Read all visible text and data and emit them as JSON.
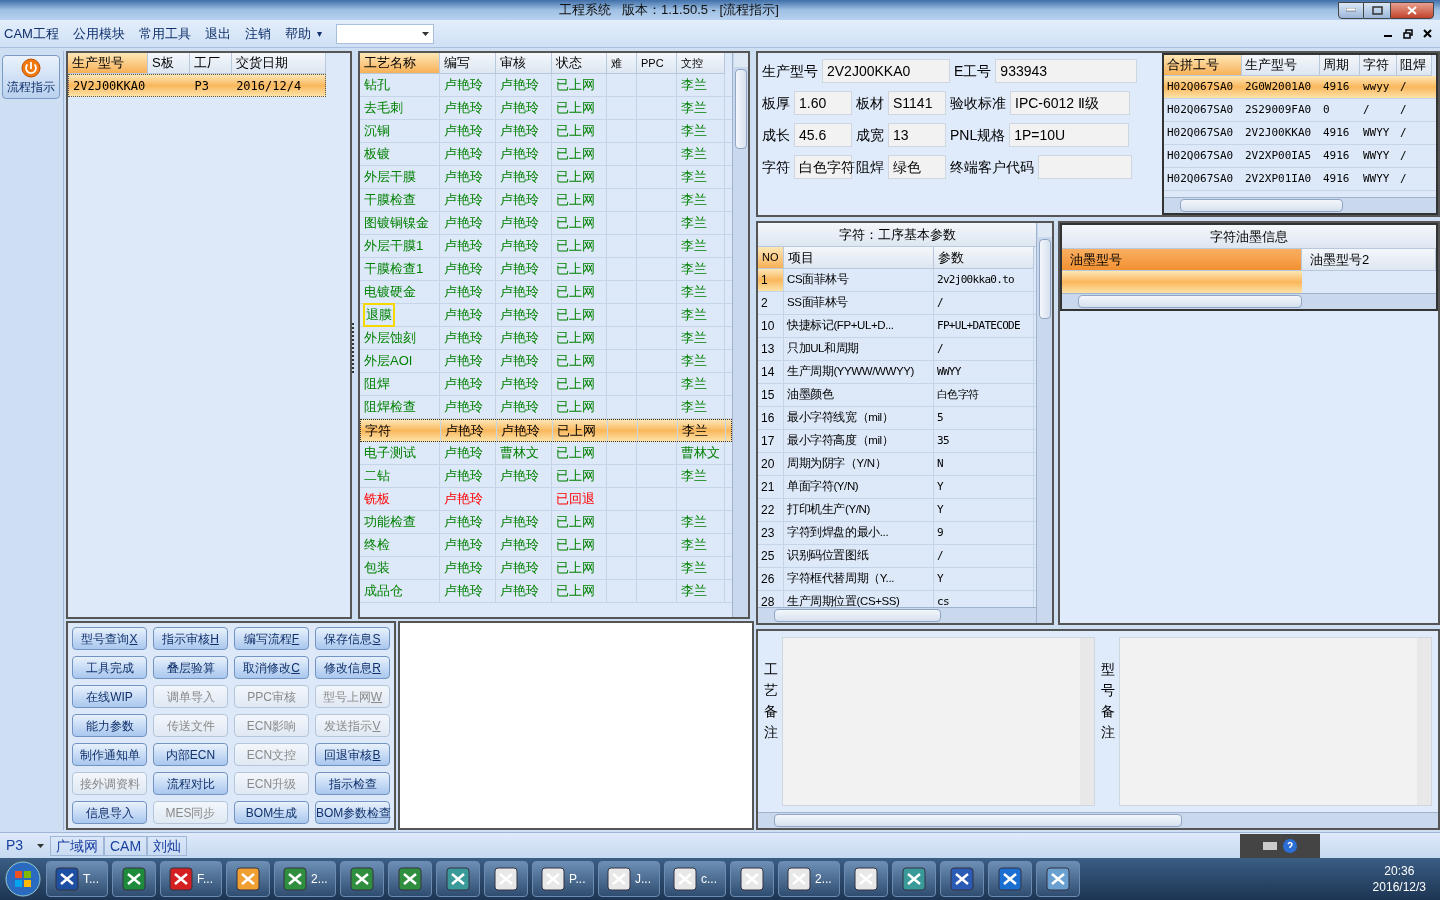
{
  "window": {
    "title": "工程系统   版本：1.1.50.5 - [流程指示]"
  },
  "menu": {
    "items": [
      "CAM工程",
      "公用模块",
      "常用工具",
      "退出",
      "注销",
      "帮助"
    ],
    "overflow": "▾"
  },
  "sidebar": {
    "items": [
      {
        "label": "流程指示",
        "selected": true
      }
    ]
  },
  "model_table": {
    "columns": [
      "生产型号",
      "S板",
      "工厂",
      "交货日期"
    ],
    "rows": [
      {
        "cells": [
          "2V2J00KKA0",
          "",
          "P3",
          "2016/12/4"
        ],
        "selected": true
      }
    ]
  },
  "process_table": {
    "columns": [
      "工艺名称",
      "编写",
      "审核",
      "状态",
      "难",
      "PPC",
      "文控"
    ],
    "rows": [
      {
        "cells": [
          "钻孔",
          "卢艳玲",
          "卢艳玲",
          "已上网",
          "",
          "",
          "李兰"
        ],
        "kind": "online",
        "selected": false,
        "focused": false
      },
      {
        "cells": [
          "去毛刺",
          "卢艳玲",
          "卢艳玲",
          "已上网",
          "",
          "",
          "李兰"
        ],
        "kind": "online",
        "selected": false,
        "focused": false
      },
      {
        "cells": [
          "沉铜",
          "卢艳玲",
          "卢艳玲",
          "已上网",
          "",
          "",
          "李兰"
        ],
        "kind": "online",
        "selected": false,
        "focused": false
      },
      {
        "cells": [
          "板镀",
          "卢艳玲",
          "卢艳玲",
          "已上网",
          "",
          "",
          "李兰"
        ],
        "kind": "online",
        "selected": false,
        "focused": false
      },
      {
        "cells": [
          "外层干膜",
          "卢艳玲",
          "卢艳玲",
          "已上网",
          "",
          "",
          "李兰"
        ],
        "kind": "online",
        "selected": false,
        "focused": false
      },
      {
        "cells": [
          "干膜检查",
          "卢艳玲",
          "卢艳玲",
          "已上网",
          "",
          "",
          "李兰"
        ],
        "kind": "online",
        "selected": false,
        "focused": false
      },
      {
        "cells": [
          "图镀铜镍金",
          "卢艳玲",
          "卢艳玲",
          "已上网",
          "",
          "",
          "李兰"
        ],
        "kind": "online",
        "selected": false,
        "focused": false
      },
      {
        "cells": [
          "外层干膜1",
          "卢艳玲",
          "卢艳玲",
          "已上网",
          "",
          "",
          "李兰"
        ],
        "kind": "online",
        "selected": false,
        "focused": false
      },
      {
        "cells": [
          "干膜检查1",
          "卢艳玲",
          "卢艳玲",
          "已上网",
          "",
          "",
          "李兰"
        ],
        "kind": "online",
        "selected": false,
        "focused": false
      },
      {
        "cells": [
          "电镀硬金",
          "卢艳玲",
          "卢艳玲",
          "已上网",
          "",
          "",
          "李兰"
        ],
        "kind": "online",
        "selected": false,
        "focused": false
      },
      {
        "cells": [
          "退膜",
          "卢艳玲",
          "卢艳玲",
          "已上网",
          "",
          "",
          "李兰"
        ],
        "kind": "online",
        "selected": false,
        "focused": true
      },
      {
        "cells": [
          "外层蚀刻",
          "卢艳玲",
          "卢艳玲",
          "已上网",
          "",
          "",
          "李兰"
        ],
        "kind": "online",
        "selected": false,
        "focused": false
      },
      {
        "cells": [
          "外层AOI",
          "卢艳玲",
          "卢艳玲",
          "已上网",
          "",
          "",
          "李兰"
        ],
        "kind": "online",
        "selected": false,
        "focused": false
      },
      {
        "cells": [
          "阻焊",
          "卢艳玲",
          "卢艳玲",
          "已上网",
          "",
          "",
          "李兰"
        ],
        "kind": "online",
        "selected": false,
        "focused": false
      },
      {
        "cells": [
          "阻焊检查",
          "卢艳玲",
          "卢艳玲",
          "已上网",
          "",
          "",
          "李兰"
        ],
        "kind": "online",
        "selected": false,
        "focused": false
      },
      {
        "cells": [
          "字符",
          "卢艳玲",
          "卢艳玲",
          "已上网",
          "",
          "",
          "李兰"
        ],
        "kind": "online",
        "selected": true,
        "focused": false
      },
      {
        "cells": [
          "电子测试",
          "卢艳玲",
          "曹林文",
          "已上网",
          "",
          "",
          "曹林文"
        ],
        "kind": "online",
        "selected": false,
        "focused": false
      },
      {
        "cells": [
          "二钻",
          "卢艳玲",
          "卢艳玲",
          "已上网",
          "",
          "",
          "李兰"
        ],
        "kind": "online",
        "selected": false,
        "focused": false
      },
      {
        "cells": [
          "铣板",
          "卢艳玲",
          "",
          "已回退",
          "",
          "",
          ""
        ],
        "kind": "returned",
        "selected": false,
        "focused": false
      },
      {
        "cells": [
          "功能检查",
          "卢艳玲",
          "卢艳玲",
          "已上网",
          "",
          "",
          "李兰"
        ],
        "kind": "online",
        "selected": false,
        "focused": false
      },
      {
        "cells": [
          "终检",
          "卢艳玲",
          "卢艳玲",
          "已上网",
          "",
          "",
          "李兰"
        ],
        "kind": "online",
        "selected": false,
        "focused": false
      },
      {
        "cells": [
          "包装",
          "卢艳玲",
          "卢艳玲",
          "已上网",
          "",
          "",
          "李兰"
        ],
        "kind": "online",
        "selected": false,
        "focused": false
      },
      {
        "cells": [
          "成品仓",
          "卢艳玲",
          "卢艳玲",
          "已上网",
          "",
          "",
          "李兰"
        ],
        "kind": "online",
        "selected": false,
        "focused": false
      }
    ]
  },
  "buttons": [
    {
      "label": "型号查询",
      "hotkey": "X",
      "disabled": false
    },
    {
      "label": "指示审核",
      "hotkey": "H",
      "disabled": false
    },
    {
      "label": "编写流程",
      "hotkey": "F",
      "disabled": false
    },
    {
      "label": "保存信息",
      "hotkey": "S",
      "disabled": false
    },
    {
      "label": "工具完成",
      "disabled": false
    },
    {
      "label": "叠层验算",
      "disabled": false
    },
    {
      "label": "取消修改",
      "hotkey": "C",
      "disabled": false
    },
    {
      "label": "修改信息",
      "hotkey": "R",
      "disabled": false
    },
    {
      "label": "在线WIP",
      "disabled": false
    },
    {
      "label": "调单导入",
      "disabled": true
    },
    {
      "label": "PPC审核",
      "disabled": true
    },
    {
      "label": "型号上网",
      "hotkey": "W",
      "disabled": true
    },
    {
      "label": "能力参数",
      "disabled": false
    },
    {
      "label": "传送文件",
      "disabled": true
    },
    {
      "label": "ECN影响",
      "disabled": true
    },
    {
      "label": "发送指示",
      "hotkey": "V",
      "disabled": true
    },
    {
      "label": "制作通知单",
      "disabled": false
    },
    {
      "label": "内部ECN",
      "disabled": false
    },
    {
      "label": "ECN文控",
      "disabled": true
    },
    {
      "label": "回退审核",
      "hotkey": "B",
      "disabled": false
    },
    {
      "label": "接外调资料",
      "disabled": true
    },
    {
      "label": "流程对比",
      "disabled": false
    },
    {
      "label": "ECN升级",
      "disabled": true
    },
    {
      "label": "指示检查",
      "disabled": false
    },
    {
      "label": "信息导入",
      "disabled": false
    },
    {
      "label": "MES同步",
      "disabled": true
    },
    {
      "label": "BOM生成",
      "disabled": false
    },
    {
      "label": "BOM参数检查",
      "disabled": false
    }
  ],
  "info_form": {
    "top": [
      {
        "label": "生产型号",
        "value": "2V2J00KKA0"
      },
      {
        "label": "E工号",
        "value": "933943"
      }
    ],
    "rows": [
      [
        {
          "label": "板厚",
          "value": "1.60"
        },
        {
          "label": "板材",
          "value": "S1141"
        },
        {
          "label": "验收标准",
          "value": "IPC-6012 Ⅱ级"
        }
      ],
      [
        {
          "label": "成长",
          "value": "45.6"
        },
        {
          "label": "成宽",
          "value": "13"
        },
        {
          "label": "PNL规格",
          "value": "1P=10U"
        }
      ],
      [
        {
          "label": "字符",
          "value": "白色字符"
        },
        {
          "label": "阻焊",
          "value": "绿色"
        },
        {
          "label": "终端客户代码"
        }
      ]
    ]
  },
  "merge_table": {
    "columns": [
      "合拼工号",
      "生产型号",
      "周期",
      "字符",
      "阻焊"
    ],
    "rows": [
      {
        "cells": [
          "H02Q067SA0",
          "2G0W2001A0",
          "4916",
          "wwyy",
          "/"
        ],
        "selected": true
      },
      {
        "cells": [
          "H02Q067SA0",
          "2S29009FA0",
          "0",
          "/",
          "/"
        ],
        "selected": false
      },
      {
        "cells": [
          "H02Q067SA0",
          "2V2J00KKA0",
          "4916",
          "WWYY",
          "/"
        ],
        "selected": false
      },
      {
        "cells": [
          "H02Q067SA0",
          "2V2XP00IA5",
          "4916",
          "WWYY",
          "/"
        ],
        "selected": false
      },
      {
        "cells": [
          "H02Q067SA0",
          "2V2XP01IA0",
          "4916",
          "WWYY",
          "/"
        ],
        "selected": false
      }
    ]
  },
  "param_table": {
    "title": "字符：工序基本参数",
    "columns": [
      "NO",
      "项目",
      "参数"
    ],
    "rows": [
      {
        "cells": [
          "1",
          "CS面菲林号",
          "2v2j00kka0.to"
        ],
        "selected": true
      },
      {
        "cells": [
          "2",
          "SS面菲林号",
          "/"
        ],
        "selected": false
      },
      {
        "cells": [
          "10",
          "快捷标记(FP+UL+D...",
          "FP+UL+DATECODE"
        ],
        "selected": false
      },
      {
        "cells": [
          "13",
          "只加UL和周期",
          "/"
        ],
        "selected": false
      },
      {
        "cells": [
          "14",
          "生产周期(YYWW/WWYY)",
          "WWYY"
        ],
        "selected": false
      },
      {
        "cells": [
          "15",
          "油墨颜色",
          "白色字符"
        ],
        "selected": false
      },
      {
        "cells": [
          "16",
          "最小字符线宽（mil）",
          "5"
        ],
        "selected": false
      },
      {
        "cells": [
          "17",
          "最小字符高度（mil）",
          "35"
        ],
        "selected": false
      },
      {
        "cells": [
          "20",
          "周期为阴字（Y/N）",
          "N"
        ],
        "selected": false
      },
      {
        "cells": [
          "21",
          "单面字符(Y/N)",
          "Y"
        ],
        "selected": false
      },
      {
        "cells": [
          "22",
          "打印机生产(Y/N)",
          "Y"
        ],
        "selected": false
      },
      {
        "cells": [
          "23",
          "字符到焊盘的最小...",
          "9"
        ],
        "selected": false
      },
      {
        "cells": [
          "25",
          "识别码位置图纸",
          "/"
        ],
        "selected": false
      },
      {
        "cells": [
          "26",
          "字符框代替周期（Y...",
          "Y"
        ],
        "selected": false
      },
      {
        "cells": [
          "28",
          "生产周期位置(CS+SS)",
          "cs"
        ],
        "selected": false
      }
    ]
  },
  "ink_table": {
    "title": "字符油墨信息",
    "columns": [
      {
        "label": "油墨型号",
        "selected": true
      },
      {
        "label": "油墨型号2",
        "selected": false
      }
    ]
  },
  "notes": [
    {
      "label": "工艺备注"
    },
    {
      "label": "型号备注"
    }
  ],
  "status_bar": {
    "factory": "P3",
    "tabs": [
      "广域网",
      "CAM",
      "刘灿"
    ]
  },
  "taskbar": {
    "items": [
      {
        "kind": "labeled",
        "label": "T..."
      },
      {
        "kind": "icon"
      },
      {
        "kind": "labeled",
        "label": "F..."
      },
      {
        "kind": "icon"
      },
      {
        "kind": "labeled",
        "label": "2..."
      },
      {
        "kind": "icon"
      },
      {
        "kind": "icon"
      },
      {
        "kind": "icon"
      },
      {
        "kind": "icon"
      },
      {
        "kind": "labeled",
        "label": "P..."
      },
      {
        "kind": "labeled",
        "label": "J..."
      },
      {
        "kind": "labeled",
        "label": "c..."
      },
      {
        "kind": "icon"
      },
      {
        "kind": "labeled",
        "label": "2..."
      },
      {
        "kind": "icon"
      },
      {
        "kind": "icon"
      },
      {
        "kind": "icon"
      },
      {
        "kind": "icon"
      },
      {
        "kind": "icon"
      }
    ],
    "time": "20:36",
    "date": "2016/12/3"
  }
}
